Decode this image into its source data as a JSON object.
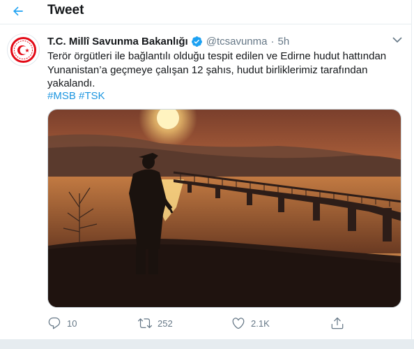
{
  "header": {
    "title": "Tweet"
  },
  "tweet": {
    "display_name": "T.C. Millî Savunma Bakanlığı",
    "handle": "@tcsavunma",
    "separator": "·",
    "time": "5h",
    "text_lines": [
      "Terör örgütleri ile bağlantılı olduğu tespit edilen ve Edirne hudut hattından",
      "Yunanistan’a geçmeye çalışan 12 şahıs, hudut birliklerimiz tarafından",
      "yakalandı."
    ],
    "hashtags": [
      "#MSB",
      "#TSK"
    ],
    "counts": {
      "replies": "10",
      "retweets": "252",
      "likes": "2.1K"
    }
  },
  "colors": {
    "accent": "#1da1f2",
    "link": "#1b95e0",
    "muted": "#657786",
    "avatar_red": "#e30a17"
  },
  "icons": [
    "back-arrow-icon",
    "verified-badge-icon",
    "chevron-down-icon",
    "reply-icon",
    "retweet-icon",
    "like-icon",
    "share-icon"
  ]
}
